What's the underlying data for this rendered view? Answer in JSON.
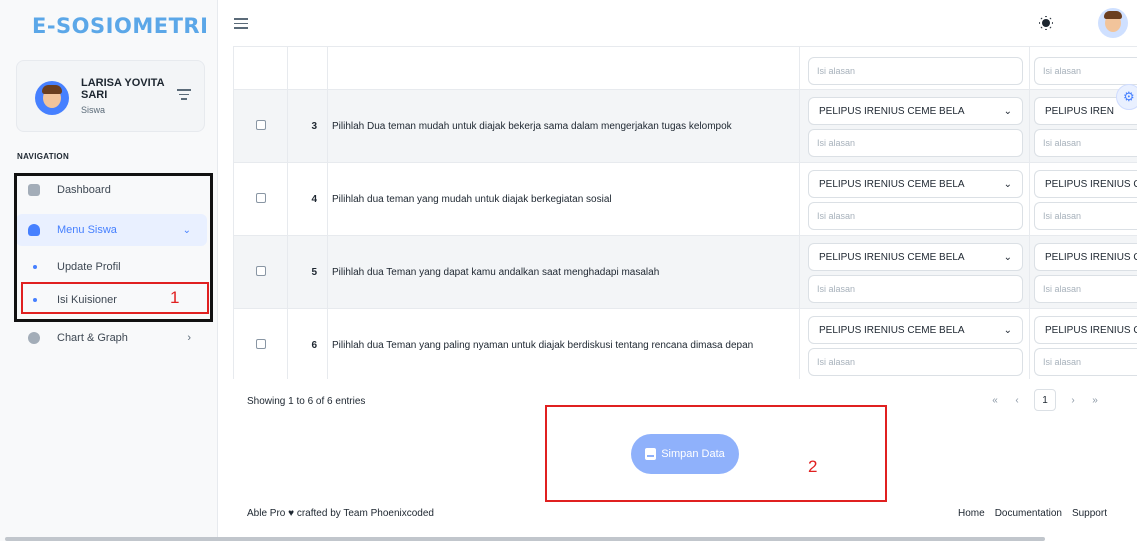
{
  "app": {
    "logo": "E-SOSIOMETRI"
  },
  "user": {
    "name": "LARISA YOVITA SARI",
    "role": "Siswa"
  },
  "nav": {
    "caption": "NAVIGATION",
    "dashboard": "Dashboard",
    "menu_siswa": "Menu Siswa",
    "update_profil": "Update Profil",
    "isi_kuisioner": "Isi Kuisioner",
    "chart_graph": "Chart & Graph"
  },
  "questions": [
    {
      "num": "",
      "text": "",
      "select1": "",
      "select2": "",
      "reason_placeholder": "Isi alasan"
    },
    {
      "num": "3",
      "text": "Pilihlah Dua teman mudah untuk diajak bekerja sama dalam mengerjakan tugas kelompok",
      "select1": "PELIPUS IRENIUS CEME BELA",
      "select2": "PELIPUS IREN",
      "reason_placeholder": "Isi alasan"
    },
    {
      "num": "4",
      "text": "Pilihlah dua teman yang mudah untuk diajak berkegiatan sosial",
      "select1": "PELIPUS IRENIUS CEME BELA",
      "select2": "PELIPUS IRENIUS C",
      "reason_placeholder": "Isi alasan"
    },
    {
      "num": "5",
      "text": "Pilihlah dua Teman yang dapat kamu andalkan saat menghadapi masalah",
      "select1": "PELIPUS IRENIUS CEME BELA",
      "select2": "PELIPUS IRENIUS C",
      "reason_placeholder": "Isi alasan"
    },
    {
      "num": "6",
      "text": "Pilihlah dua Teman yang paling nyaman untuk diajak berdiskusi tentang rencana dimasa depan",
      "select1": "PELIPUS IRENIUS CEME BELA",
      "select2": "PELIPUS IRENIUS C",
      "reason_placeholder": "Isi alasan"
    }
  ],
  "table_info": "Showing 1 to 6 of 6 entries",
  "pagination": {
    "first": "«",
    "prev": "‹",
    "current": "1",
    "next": "›",
    "last": "»"
  },
  "save_button": "Simpan Data",
  "footer": {
    "credit": "Able Pro ♥ crafted by Team Phoenixcoded",
    "home": "Home",
    "documentation": "Documentation",
    "support": "Support"
  },
  "annotations": {
    "label1": "1",
    "label2": "2",
    "box_color": "#e02020"
  },
  "colors": {
    "primary": "#4680ff",
    "logo": "#5ba7e8",
    "button": "#8fb1fb"
  },
  "icons": [
    "menu-icon",
    "sun-icon",
    "filter-icon",
    "dashboard-icon",
    "user-icon",
    "chart-icon",
    "chevron-down-icon",
    "chevron-right-icon",
    "save-disk-icon",
    "gear-icon"
  ]
}
